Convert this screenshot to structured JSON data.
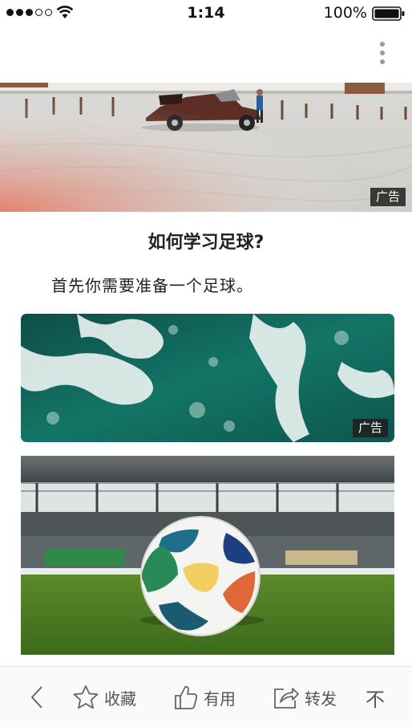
{
  "status_bar": {
    "time": "1:14",
    "battery_percent": "100%",
    "signal_filled": 3,
    "signal_total": 5
  },
  "top_bar": {
    "more_icon": "more-vertical-icon"
  },
  "article": {
    "hero_ad_label": "广告",
    "title": "如何学习足球?",
    "paragraph": "首先你需要准备一个足球。",
    "inline_ad_label": "广告"
  },
  "toolbar": {
    "back_icon": "chevron-left-icon",
    "favorite_label": "收藏",
    "favorite_icon": "star-icon",
    "useful_label": "有用",
    "useful_icon": "thumbs-up-icon",
    "share_label": "转发",
    "share_icon": "share-icon",
    "dislike_icon": "thumbs-down-icon",
    "dislike_label": "不"
  },
  "colors": {
    "background": "#ffffff",
    "text": "#222222",
    "toolbar_text": "#555555",
    "ad_badge_bg": "#1e1e1e",
    "more_dots": "#9a9a9a"
  }
}
